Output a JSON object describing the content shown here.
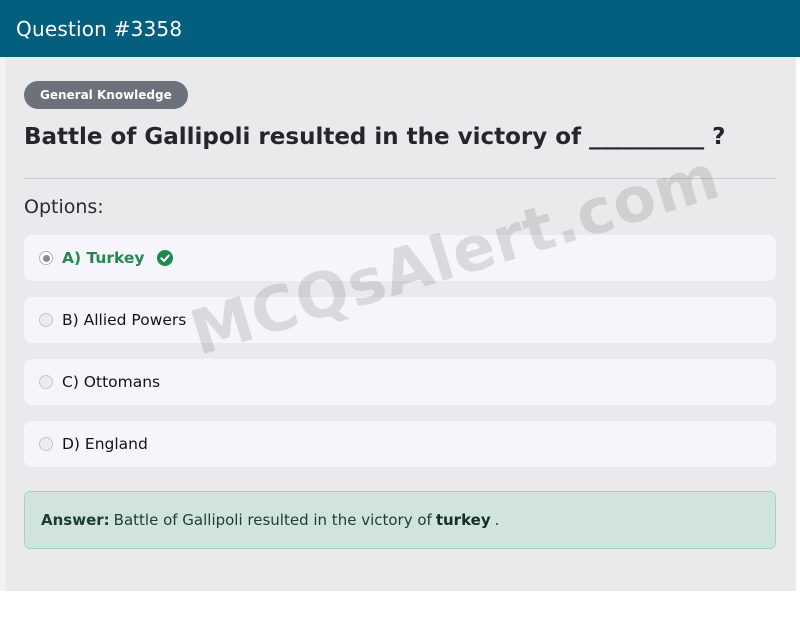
{
  "header": {
    "title": "Question #3358"
  },
  "question": {
    "category": "General Knowledge",
    "text": "Battle of Gallipoli resulted in the victory of __________ ?"
  },
  "options_heading": "Options:",
  "options": [
    {
      "label": "A) Turkey",
      "selected": true,
      "correct": true
    },
    {
      "label": "B) Allied Powers",
      "selected": false,
      "correct": false
    },
    {
      "label": "C) Ottomans",
      "selected": false,
      "correct": false
    },
    {
      "label": "D) England",
      "selected": false,
      "correct": false
    }
  ],
  "answer": {
    "prefix": "Answer:",
    "text": "Battle of Gallipoli resulted in the victory of",
    "value": "turkey",
    "suffix": "."
  },
  "watermark": "MCQsAlert.com",
  "colors": {
    "header_bg": "#045e7d",
    "correct": "#25894f",
    "answer_bg": "#d1e4dc",
    "badge_bg": "#6c717b"
  },
  "icons": {
    "correct_option": "check-circle-icon"
  }
}
